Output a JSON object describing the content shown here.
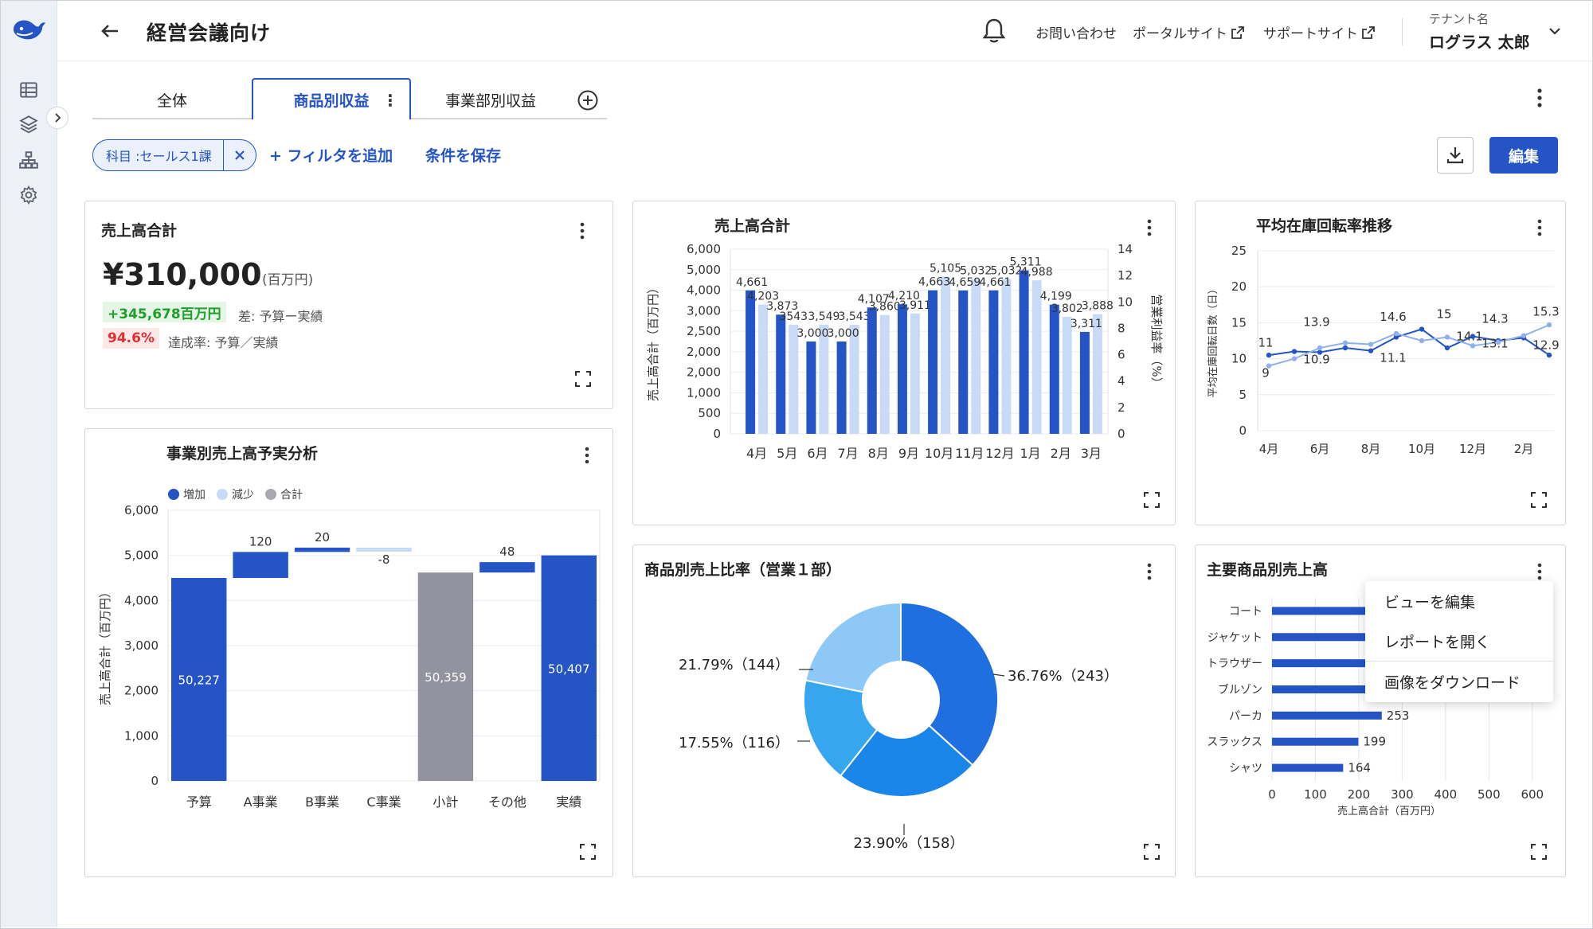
{
  "header": {
    "title": "経営会議向け",
    "links": [
      "お問い合わせ",
      "ポータルサイト",
      "サポートサイト"
    ],
    "tenant_label": "テナント名",
    "user_name": "ログラス 太郎"
  },
  "tabs": [
    "全体",
    "商品別収益",
    "事業部別収益"
  ],
  "active_tab": 1,
  "filters": {
    "chip_label": "科目 :セールス1課",
    "add_filter": "+ フィルタを追加",
    "save_conditions": "条件を保存"
  },
  "toolbar": {
    "edit_label": "編集"
  },
  "colors": {
    "primary": "#2454c6",
    "light": "#c9daf6",
    "gray": "#93939f"
  },
  "kpi_card": {
    "title": "売上高合計",
    "value": "¥310,000",
    "unit": "(百万円)",
    "diff_value": "+345,678百万円",
    "diff_label": "差: 予算ー実績",
    "rate_value": "94.6%",
    "rate_label": "達成率: 予算／実績"
  },
  "context_menu": {
    "items": [
      "ビューを編集",
      "レポートを開く",
      "画像をダウンロード"
    ]
  },
  "chart_data": [
    {
      "type": "bar",
      "title": "売上高合計",
      "ylabel": "売上高合計（百万円）",
      "y2label": "営業利益率（%）",
      "categories": [
        "4月",
        "5月",
        "6月",
        "7月",
        "8月",
        "9月",
        "10月",
        "11月",
        "12月",
        "1月",
        "2月",
        "3月"
      ],
      "yticks": [
        "0",
        "500",
        "1,000",
        "2,000",
        "2,000",
        "2,500",
        "3,000",
        "4,000",
        "5,000",
        "6,000"
      ],
      "y2ticks": [
        "0",
        "2",
        "4",
        "6",
        "8",
        "10",
        "12",
        "14"
      ],
      "ylim": [
        0,
        6000
      ],
      "series": [
        {
          "values": [
            4661,
            3873,
            3000,
            3000,
            4107,
            4210,
            4663,
            4659,
            4661,
            5311,
            4199,
            3311
          ]
        },
        {
          "values": [
            4203,
            3543,
            3549,
            3543,
            3860,
            3911,
            5105,
            5032,
            5032,
            4988,
            3802,
            3888
          ]
        }
      ],
      "labels_dark": [
        "4,661",
        "3,873",
        "3,000",
        "3,000",
        "4,107",
        "4,210",
        "4,663",
        "4,659",
        "4,661",
        "5,311",
        "4,199",
        "3,311"
      ],
      "labels_light": [
        "4,203",
        "3543",
        "3,549",
        "3,543",
        "3,860",
        "3,911",
        "5,105",
        "5,032",
        "5,032",
        "4,988",
        "3,802",
        "3,888"
      ]
    },
    {
      "type": "line",
      "title": "平均在庫回転率推移",
      "ylabel": "平均在庫回転日数（日）",
      "x": [
        "4月",
        "6月",
        "8月",
        "10月",
        "12月",
        "2月"
      ],
      "ylim": [
        0,
        25
      ],
      "yticks": [
        "0",
        "5",
        "10",
        "15",
        "20",
        "25"
      ],
      "series": [
        {
          "values": [
            10.5,
            11,
            10.9,
            11.5,
            11.1,
            13,
            14.1,
            11.5,
            13.1,
            12.5,
            12.9,
            10.5
          ]
        },
        {
          "values": [
            9,
            10,
            11.5,
            12.2,
            12,
            13.5,
            12.5,
            13,
            11.8,
            12.3,
            13.2,
            14.7
          ]
        }
      ],
      "annotations": [
        "11",
        "9",
        "13.9",
        "10.9",
        "14.6",
        "11.1",
        "15",
        "14.1",
        "14.3",
        "13.1",
        "15.3",
        "12.9"
      ]
    },
    {
      "type": "bar",
      "title": "事業別売上高予実分析",
      "legend": [
        "増加",
        "減少",
        "合計"
      ],
      "ylabel": "売上高合計（百万円）",
      "categories": [
        "予算",
        "A事業",
        "B事業",
        "C事業",
        "小計",
        "その他",
        "実績"
      ],
      "yticks": [
        "0",
        "1,000",
        "2,000",
        "3,000",
        "4,000",
        "5,000",
        "6,000"
      ],
      "ylim": [
        0,
        6000
      ],
      "values": [
        4500,
        120,
        20,
        -8,
        4620,
        48,
        5000
      ],
      "labels": [
        "50,227",
        "120",
        "20",
        "-8",
        "50,359",
        "48",
        "50,407"
      ]
    },
    {
      "type": "pie",
      "title": "商品別売上比率（営業１部）",
      "values": [
        36.76,
        23.9,
        17.55,
        21.79
      ],
      "labels": [
        "36.76%（243）",
        "23.90%（158）",
        "17.55%（116）",
        "21.79%（144）"
      ]
    },
    {
      "type": "bar",
      "title": "主要商品別売上高",
      "categories": [
        "コート",
        "ジャケット",
        "トラウザー",
        "ブルゾン",
        "パーカ",
        "スラックス",
        "シャツ"
      ],
      "values": [
        300,
        290,
        280,
        270,
        253,
        199,
        164
      ],
      "value_labels": [
        "253",
        "199",
        "164"
      ],
      "xlabel": "売上高合計（百万円）",
      "xticks": [
        "0",
        "100",
        "200",
        "300",
        "400",
        "500",
        "600"
      ],
      "xlim": [
        0,
        650
      ]
    }
  ]
}
